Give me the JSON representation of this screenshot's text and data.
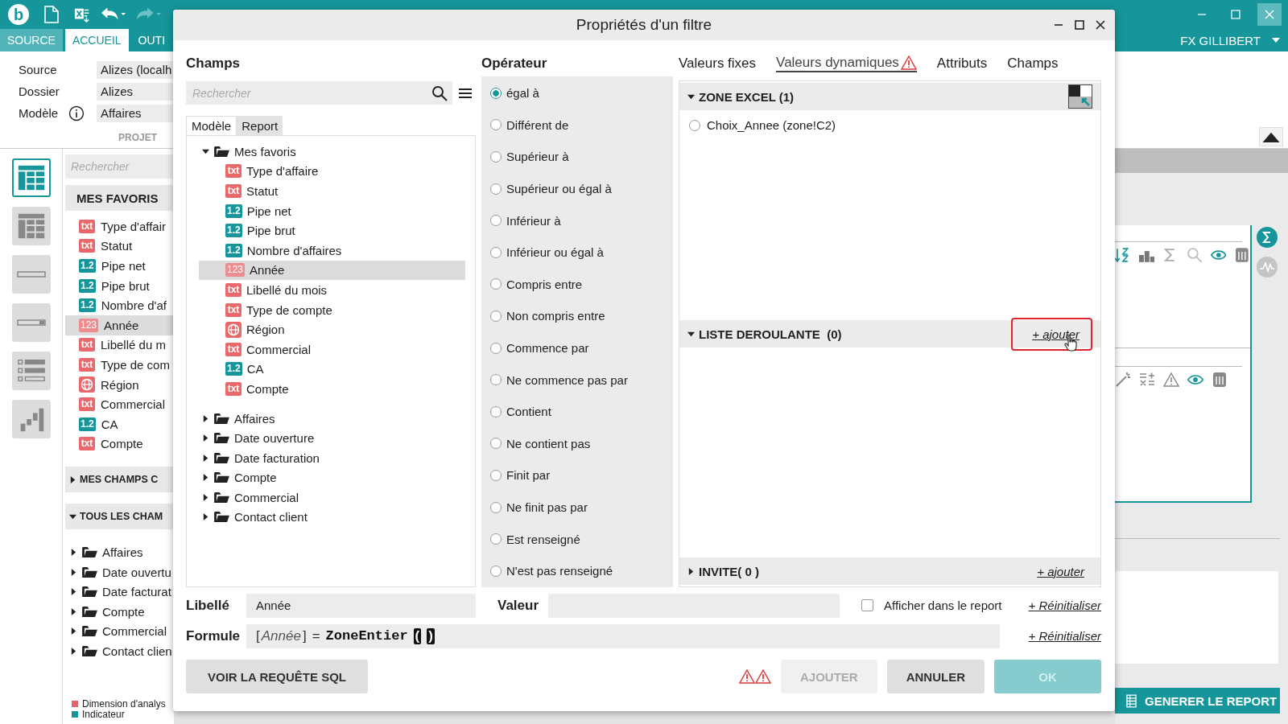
{
  "app": {
    "logo": "b",
    "user": "FX GILLIBERT",
    "ribbon_tabs": [
      {
        "label": "SOURCE",
        "selected": false,
        "kind": "context"
      },
      {
        "label": "ACCUEIL",
        "selected": true,
        "kind": "normal"
      },
      {
        "label": "OUTI",
        "selected": false,
        "kind": "normal"
      }
    ],
    "project": {
      "fields": [
        {
          "label": "Source",
          "value": "Alizes (localh",
          "info": false
        },
        {
          "label": "Dossier",
          "value": "Alizes",
          "info": false
        },
        {
          "label": "Modèle",
          "value": "Affaires",
          "info": true
        }
      ],
      "group_label": "PROJET"
    },
    "view_buttons": [
      {
        "kind": "table",
        "selected": true
      },
      {
        "kind": "grid",
        "selected": false
      },
      {
        "kind": "field",
        "selected": false
      },
      {
        "kind": "dropdown",
        "selected": false
      },
      {
        "kind": "checklist",
        "selected": false
      },
      {
        "kind": "chart",
        "selected": false
      }
    ],
    "side_panel": {
      "search_placeholder": "Rechercher",
      "favorites_title": "MES FAVORIS",
      "favorites": [
        {
          "label": "Type d'affair",
          "kind": "text",
          "badge": "txt",
          "selected": false
        },
        {
          "label": "Statut",
          "kind": "text",
          "badge": "txt",
          "selected": false
        },
        {
          "label": "Pipe net",
          "kind": "decimal",
          "badge": "1.2",
          "selected": false
        },
        {
          "label": "Pipe brut",
          "kind": "decimal",
          "badge": "1.2",
          "selected": false
        },
        {
          "label": "Nombre d'af",
          "kind": "decimal",
          "badge": "1.2",
          "selected": false
        },
        {
          "label": "Année",
          "kind": "integer",
          "badge": "123",
          "selected": true
        },
        {
          "label": "Libellé du m",
          "kind": "text",
          "badge": "txt",
          "selected": false
        },
        {
          "label": "Type de com",
          "kind": "text",
          "badge": "txt",
          "selected": false
        },
        {
          "label": "Région",
          "kind": "geo",
          "selected": false
        },
        {
          "label": "Commercial",
          "kind": "text",
          "badge": "txt",
          "selected": false
        },
        {
          "label": "CA",
          "kind": "decimal",
          "badge": "1.2",
          "selected": false
        },
        {
          "label": "Compte",
          "kind": "text",
          "badge": "txt",
          "selected": false
        }
      ],
      "sections": [
        {
          "title": "MES CHAMPS C",
          "expanded": false
        },
        {
          "title": "TOUS LES CHAM",
          "expanded": true
        }
      ],
      "tree": [
        {
          "label": "Affaires",
          "expanded": false
        },
        {
          "label": "Date ouvertu",
          "expanded": false
        },
        {
          "label": "Date facturat",
          "expanded": false
        },
        {
          "label": "Compte",
          "expanded": false
        },
        {
          "label": "Commercial",
          "expanded": false
        },
        {
          "label": "Contact clien",
          "expanded": false
        }
      ],
      "legend": [
        {
          "label": "Dimension d'analys",
          "color": "#e0646a"
        },
        {
          "label": "Indicateur",
          "color": "#16969a"
        }
      ]
    },
    "generate_button": "GENERER LE REPORT"
  },
  "dialog": {
    "title": "Propriétés d'un filtre",
    "fields_title": "Champs",
    "search_placeholder": "Rechercher",
    "source_tabs": [
      {
        "label": "Modèle",
        "selected": true
      },
      {
        "label": "Report",
        "selected": false
      }
    ],
    "fields_tree": [
      {
        "label": "Mes favoris",
        "expanded": true,
        "selected": false,
        "children": [
          {
            "label": "Type d'affaire",
            "kind": "text",
            "badge": "txt",
            "selected": false
          },
          {
            "label": "Statut",
            "kind": "text",
            "badge": "txt",
            "selected": false
          },
          {
            "label": "Pipe net",
            "kind": "decimal",
            "badge": "1.2",
            "selected": false
          },
          {
            "label": "Pipe brut",
            "kind": "decimal",
            "badge": "1.2",
            "selected": false
          },
          {
            "label": "Nombre d'affaires",
            "kind": "decimal",
            "badge": "1.2",
            "selected": false
          },
          {
            "label": "Année",
            "kind": "integer",
            "badge": "123",
            "selected": true
          },
          {
            "label": "Libellé du mois",
            "kind": "text",
            "badge": "txt",
            "selected": false
          },
          {
            "label": "Type de compte",
            "kind": "text",
            "badge": "txt",
            "selected": false
          },
          {
            "label": "Région",
            "kind": "geo",
            "selected": false
          },
          {
            "label": "Commercial",
            "kind": "text",
            "badge": "txt",
            "selected": false
          },
          {
            "label": "CA",
            "kind": "decimal",
            "badge": "1.2",
            "selected": false
          },
          {
            "label": "Compte",
            "kind": "text",
            "badge": "txt",
            "selected": false
          }
        ]
      },
      {
        "label": "Affaires",
        "expanded": false,
        "selected": false
      },
      {
        "label": "Date ouverture",
        "expanded": false,
        "selected": false
      },
      {
        "label": "Date facturation",
        "expanded": false,
        "selected": false
      },
      {
        "label": "Compte",
        "expanded": false,
        "selected": false
      },
      {
        "label": "Commercial",
        "expanded": false,
        "selected": false
      },
      {
        "label": "Contact client",
        "expanded": false,
        "selected": false
      }
    ],
    "operator_title": "Opérateur",
    "operators": [
      {
        "label": "égal à",
        "selected": true
      },
      {
        "label": "Différent de",
        "selected": false
      },
      {
        "label": "Supérieur à",
        "selected": false
      },
      {
        "label": "Supérieur ou égal à",
        "selected": false
      },
      {
        "label": "Inférieur à",
        "selected": false
      },
      {
        "label": "Inférieur ou égal à",
        "selected": false
      },
      {
        "label": "Compris entre",
        "selected": false
      },
      {
        "label": "Non compris entre",
        "selected": false
      },
      {
        "label": "Commence par",
        "selected": false
      },
      {
        "label": "Ne commence pas par",
        "selected": false
      },
      {
        "label": "Contient",
        "selected": false
      },
      {
        "label": "Ne contient pas",
        "selected": false
      },
      {
        "label": "Finit par",
        "selected": false
      },
      {
        "label": "Ne finit pas par",
        "selected": false
      },
      {
        "label": "Est renseigné",
        "selected": false
      },
      {
        "label": "N'est pas renseigné",
        "selected": false
      }
    ],
    "value_tabs": [
      {
        "label": "Valeurs fixes",
        "selected": false,
        "warning": false
      },
      {
        "label": "Valeurs dynamiques",
        "selected": true,
        "warning": true
      },
      {
        "label": "Attributs",
        "selected": false,
        "warning": false
      },
      {
        "label": "Champs",
        "selected": false,
        "warning": false
      }
    ],
    "sections": [
      {
        "title": "ZONE EXCEL (1)",
        "kind": "excel",
        "expanded": true,
        "items": [
          {
            "label": "Choix_Annee (zone!C2)",
            "selected": false
          }
        ]
      },
      {
        "title": "LISTE DEROULANTE  (0)",
        "kind": "list",
        "expanded": true,
        "add_label": "+ ajouter",
        "highlighted": true
      },
      {
        "title": "INVITE( 0 )",
        "kind": "prompt",
        "expanded": false,
        "add_label": "+ ajouter",
        "highlighted": false
      }
    ],
    "label_field": {
      "label": "Libellé",
      "value": "Année"
    },
    "value_field": {
      "label": "Valeur"
    },
    "show_in_report": {
      "label": "Afficher dans le report",
      "checked": false
    },
    "reset_links": [
      "+ Réinitialiser",
      "+ Réinitialiser"
    ],
    "formula": {
      "label": "Formule",
      "tokens": [
        {
          "text": "[",
          "kind": "plain"
        },
        {
          "text": "Année",
          "kind": "field"
        },
        {
          "text": "]",
          "kind": "plain"
        },
        {
          "text": "=",
          "kind": "plain"
        },
        {
          "text": "ZoneEntier",
          "kind": "function"
        },
        {
          "text": "(",
          "kind": "bracket"
        },
        {
          "text": ")",
          "kind": "bracket"
        }
      ]
    },
    "sql_button": {
      "label": "VOIR LA REQUÊTE SQL",
      "disabled": false
    },
    "alerts": [
      {
        "kind": "warning"
      },
      {
        "kind": "warning"
      }
    ],
    "actions": [
      {
        "label": "AJOUTER",
        "kind": "secondary",
        "disabled": true
      },
      {
        "label": "ANNULER",
        "kind": "secondary",
        "disabled": false
      },
      {
        "label": "OK",
        "kind": "primary",
        "disabled": true
      }
    ]
  }
}
